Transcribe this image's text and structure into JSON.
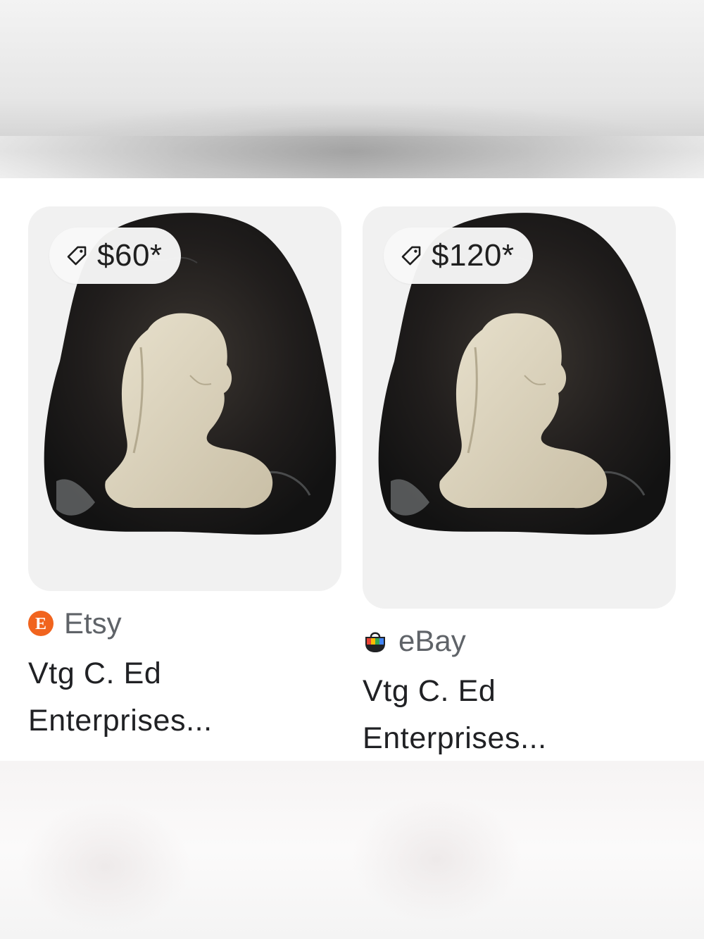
{
  "results": [
    {
      "price": "$60*",
      "source": "Etsy",
      "title_line1": "Vtg C. Ed",
      "title_line2": "Enterprises...",
      "logo_letter": "E",
      "logo_color": "#f1641e"
    },
    {
      "price": "$120*",
      "source": "eBay",
      "title_line1": "Vtg C. Ed",
      "title_line2": "Enterprises..."
    }
  ],
  "colors": {
    "pill_bg": "#f8f8f8",
    "thumb_bg": "#f1f1f1",
    "source_text": "#5f6368",
    "title_text": "#202124"
  }
}
